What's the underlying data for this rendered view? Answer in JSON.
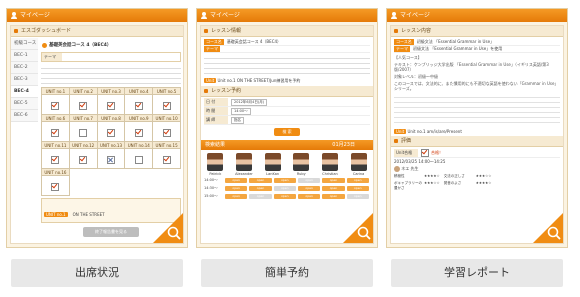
{
  "panels": [
    {
      "header": "マイページ",
      "caption": "出席状況"
    },
    {
      "header": "マイページ",
      "caption": "簡単予約"
    },
    {
      "header": "マイページ",
      "caption": "学習レポート"
    }
  ],
  "attendance": {
    "dashboard_title": "エスゴダッシュボード",
    "sidebar": [
      "初級コース",
      "BEC-1",
      "BEC-2",
      "BEC-3",
      "BEC-4",
      "BEC-5",
      "BEC-6"
    ],
    "course_heading": "基礎英会話コース 4（BEC4）",
    "theme_label": "テーマ",
    "unit_headers": [
      "UNIT no.1",
      "UNIT no.2",
      "UNIT no.3",
      "UNIT no.4",
      "UNIT no.5",
      "UNIT no.6",
      "UNIT no.7",
      "UNIT no.8",
      "UNIT no.9",
      "UNIT no.10",
      "UNIT no.11",
      "UNIT no.12",
      "UNIT no.13",
      "UNIT no.14",
      "UNIT no.15",
      "UNIT no.16"
    ],
    "unit_status": [
      "on",
      "on",
      "on",
      "on",
      "on",
      "on",
      "",
      "on",
      "on",
      "on",
      "on",
      "on",
      "x",
      "",
      "on",
      "on"
    ],
    "unit_block_title": "UNIT no.1",
    "unit_block_tag": "ON THE STREET",
    "button_label": "終了報告書を見る"
  },
  "booking": {
    "section_title": "レッスン情報",
    "course_tag": "コース名",
    "course_value": "基礎英会話コース 4（BEC4）",
    "theme_tag": "テーマ",
    "unit_label": "Unit no.1 ON THE STREET/Jun練習用を予約",
    "reserve_title": "レッスン予約",
    "rows": [
      {
        "key": "日 付",
        "value": "2012年6月4日(月)"
      },
      {
        "key": "時 間",
        "value": "14:00～"
      },
      {
        "key": "講 師",
        "value": "指名"
      }
    ],
    "search_button": "検 索",
    "result_title": "検索結果",
    "result_date": "01月23日",
    "teachers": [
      "Patrick",
      "Alexander",
      "LanKan",
      "Ruby",
      "Christian",
      "Carina"
    ],
    "times": [
      "14:00～",
      "14:30～",
      "15:00～"
    ],
    "slot_label": "open"
  },
  "report": {
    "section_title": "レッスン内容",
    "course_tag": "コース名",
    "course_value": "初級文法 「Essential Grammar in Use」",
    "level_tag": "テーマ",
    "level_value": "初級文法 「Essential Grammar in Use」を使用",
    "body": [
      "【人気コース】",
      "テキスト：ケンブリッジ大学出版 「Essential Grammar in Use」（イギリス英語/第3版/2007）",
      "対象レベル：初級～中級",
      "このコースでは、文法的に、また慣用的にも不適切な英語を使わない「Grammar in Use」シリーズ。"
    ],
    "unit_label": "Unit no.1 am/is/are/Present",
    "eval_title": "評価",
    "eval_label": "Unit合格",
    "eval_value": "合格！",
    "date_value": "2012/03/25 14:00～14:25",
    "teacher_value": "ネエ 先生",
    "rating_labels": [
      "積極性",
      "文法の正しさ",
      "ボキャブラリーの豊かさ",
      "発音のよさ"
    ]
  }
}
